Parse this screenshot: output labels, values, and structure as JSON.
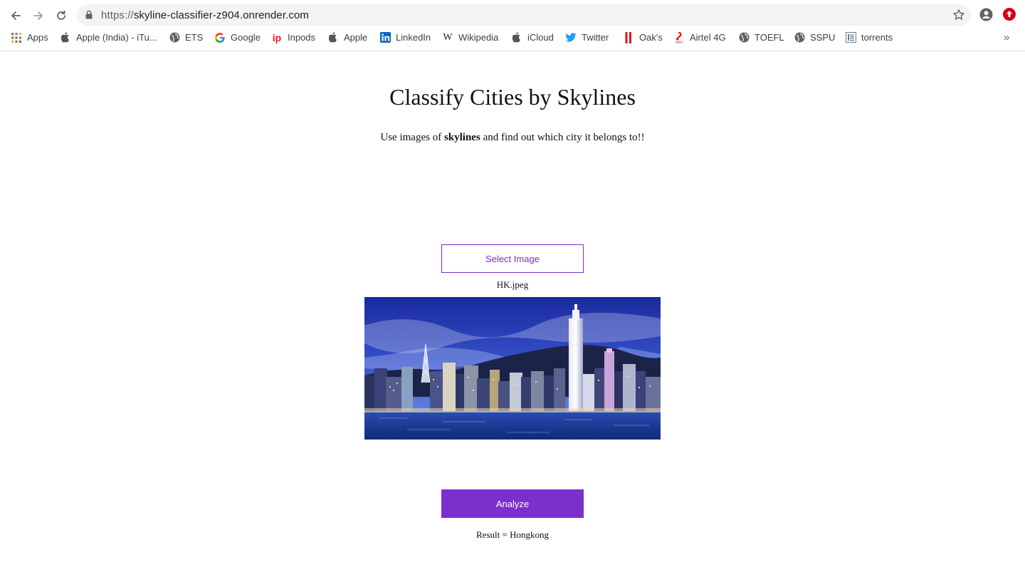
{
  "browser": {
    "url_scheme": "https://",
    "url_host": "skyline-classifier-z904.onrender.com",
    "bookmarks": [
      {
        "label": "Apps",
        "icon": "apps-grid-icon"
      },
      {
        "label": "Apple (India) - iTu...",
        "icon": "apple-icon"
      },
      {
        "label": "ETS",
        "icon": "globe-icon"
      },
      {
        "label": "Google",
        "icon": "google-icon"
      },
      {
        "label": "Inpods",
        "icon": "inpods-icon"
      },
      {
        "label": "Apple",
        "icon": "apple-icon"
      },
      {
        "label": "LinkedIn",
        "icon": "linkedin-icon"
      },
      {
        "label": "Wikipedia",
        "icon": "wikipedia-icon"
      },
      {
        "label": "iCloud",
        "icon": "apple-icon"
      },
      {
        "label": "Twitter",
        "icon": "twitter-icon"
      },
      {
        "label": "Oak's",
        "icon": "oaks-icon"
      },
      {
        "label": "Airtel 4G",
        "icon": "airtel-icon"
      },
      {
        "label": "TOEFL",
        "icon": "globe-icon"
      },
      {
        "label": "SSPU",
        "icon": "globe-icon"
      },
      {
        "label": "torrents",
        "icon": "document-icon"
      }
    ],
    "more_label": "»"
  },
  "page": {
    "title": "Classify Cities by Skylines",
    "subtitle_before": "Use images of ",
    "subtitle_bold": "skylines",
    "subtitle_after": " and find out which city it belongs to!!",
    "select_button": "Select Image",
    "filename": "HK.jpeg",
    "analyze_button": "Analyze",
    "result": "Result = Hongkong"
  },
  "colors": {
    "accent": "#7b2fcc",
    "omnibox_bg": "#f1f3f4"
  }
}
